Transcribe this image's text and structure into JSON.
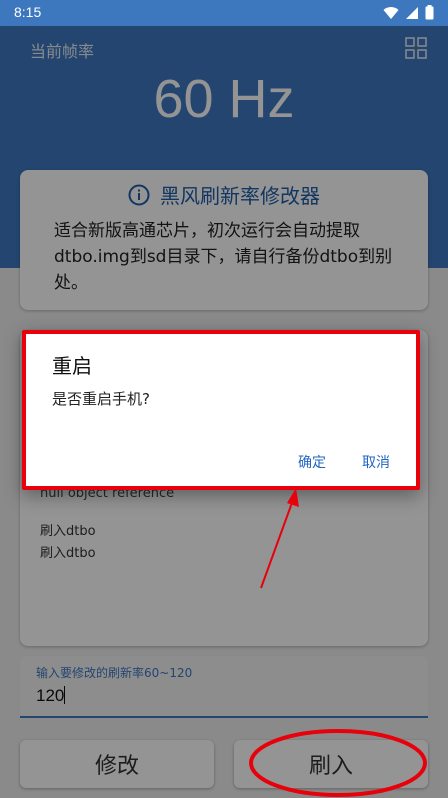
{
  "status_bar": {
    "time": "8:15"
  },
  "header": {
    "rate_label": "当前帧率",
    "rate_value": "60 Hz"
  },
  "info_card": {
    "title": "黑风刷新率修改器",
    "description": "适合新版高通芯片，初次运行会自动提取dtbo.img到sd目录下，请自行备份dtbo到别处。"
  },
  "log": {
    "partial_line": "null object reference",
    "lines": [
      "刷入dtbo",
      "刷入dtbo"
    ]
  },
  "input": {
    "label": "输入要修改的刷新率60~120",
    "value": "120"
  },
  "buttons": {
    "modify": "修改",
    "flash": "刷入"
  },
  "dialog": {
    "title": "重启",
    "message": "是否重启手机?",
    "confirm": "确定",
    "cancel": "取消"
  },
  "colors": {
    "header": "#3d78bf",
    "accent": "#1f5ea8",
    "annotation": "#e8000b"
  },
  "icons": [
    "wifi-icon",
    "signal-icon",
    "battery-icon",
    "grid-icon",
    "info-icon"
  ]
}
